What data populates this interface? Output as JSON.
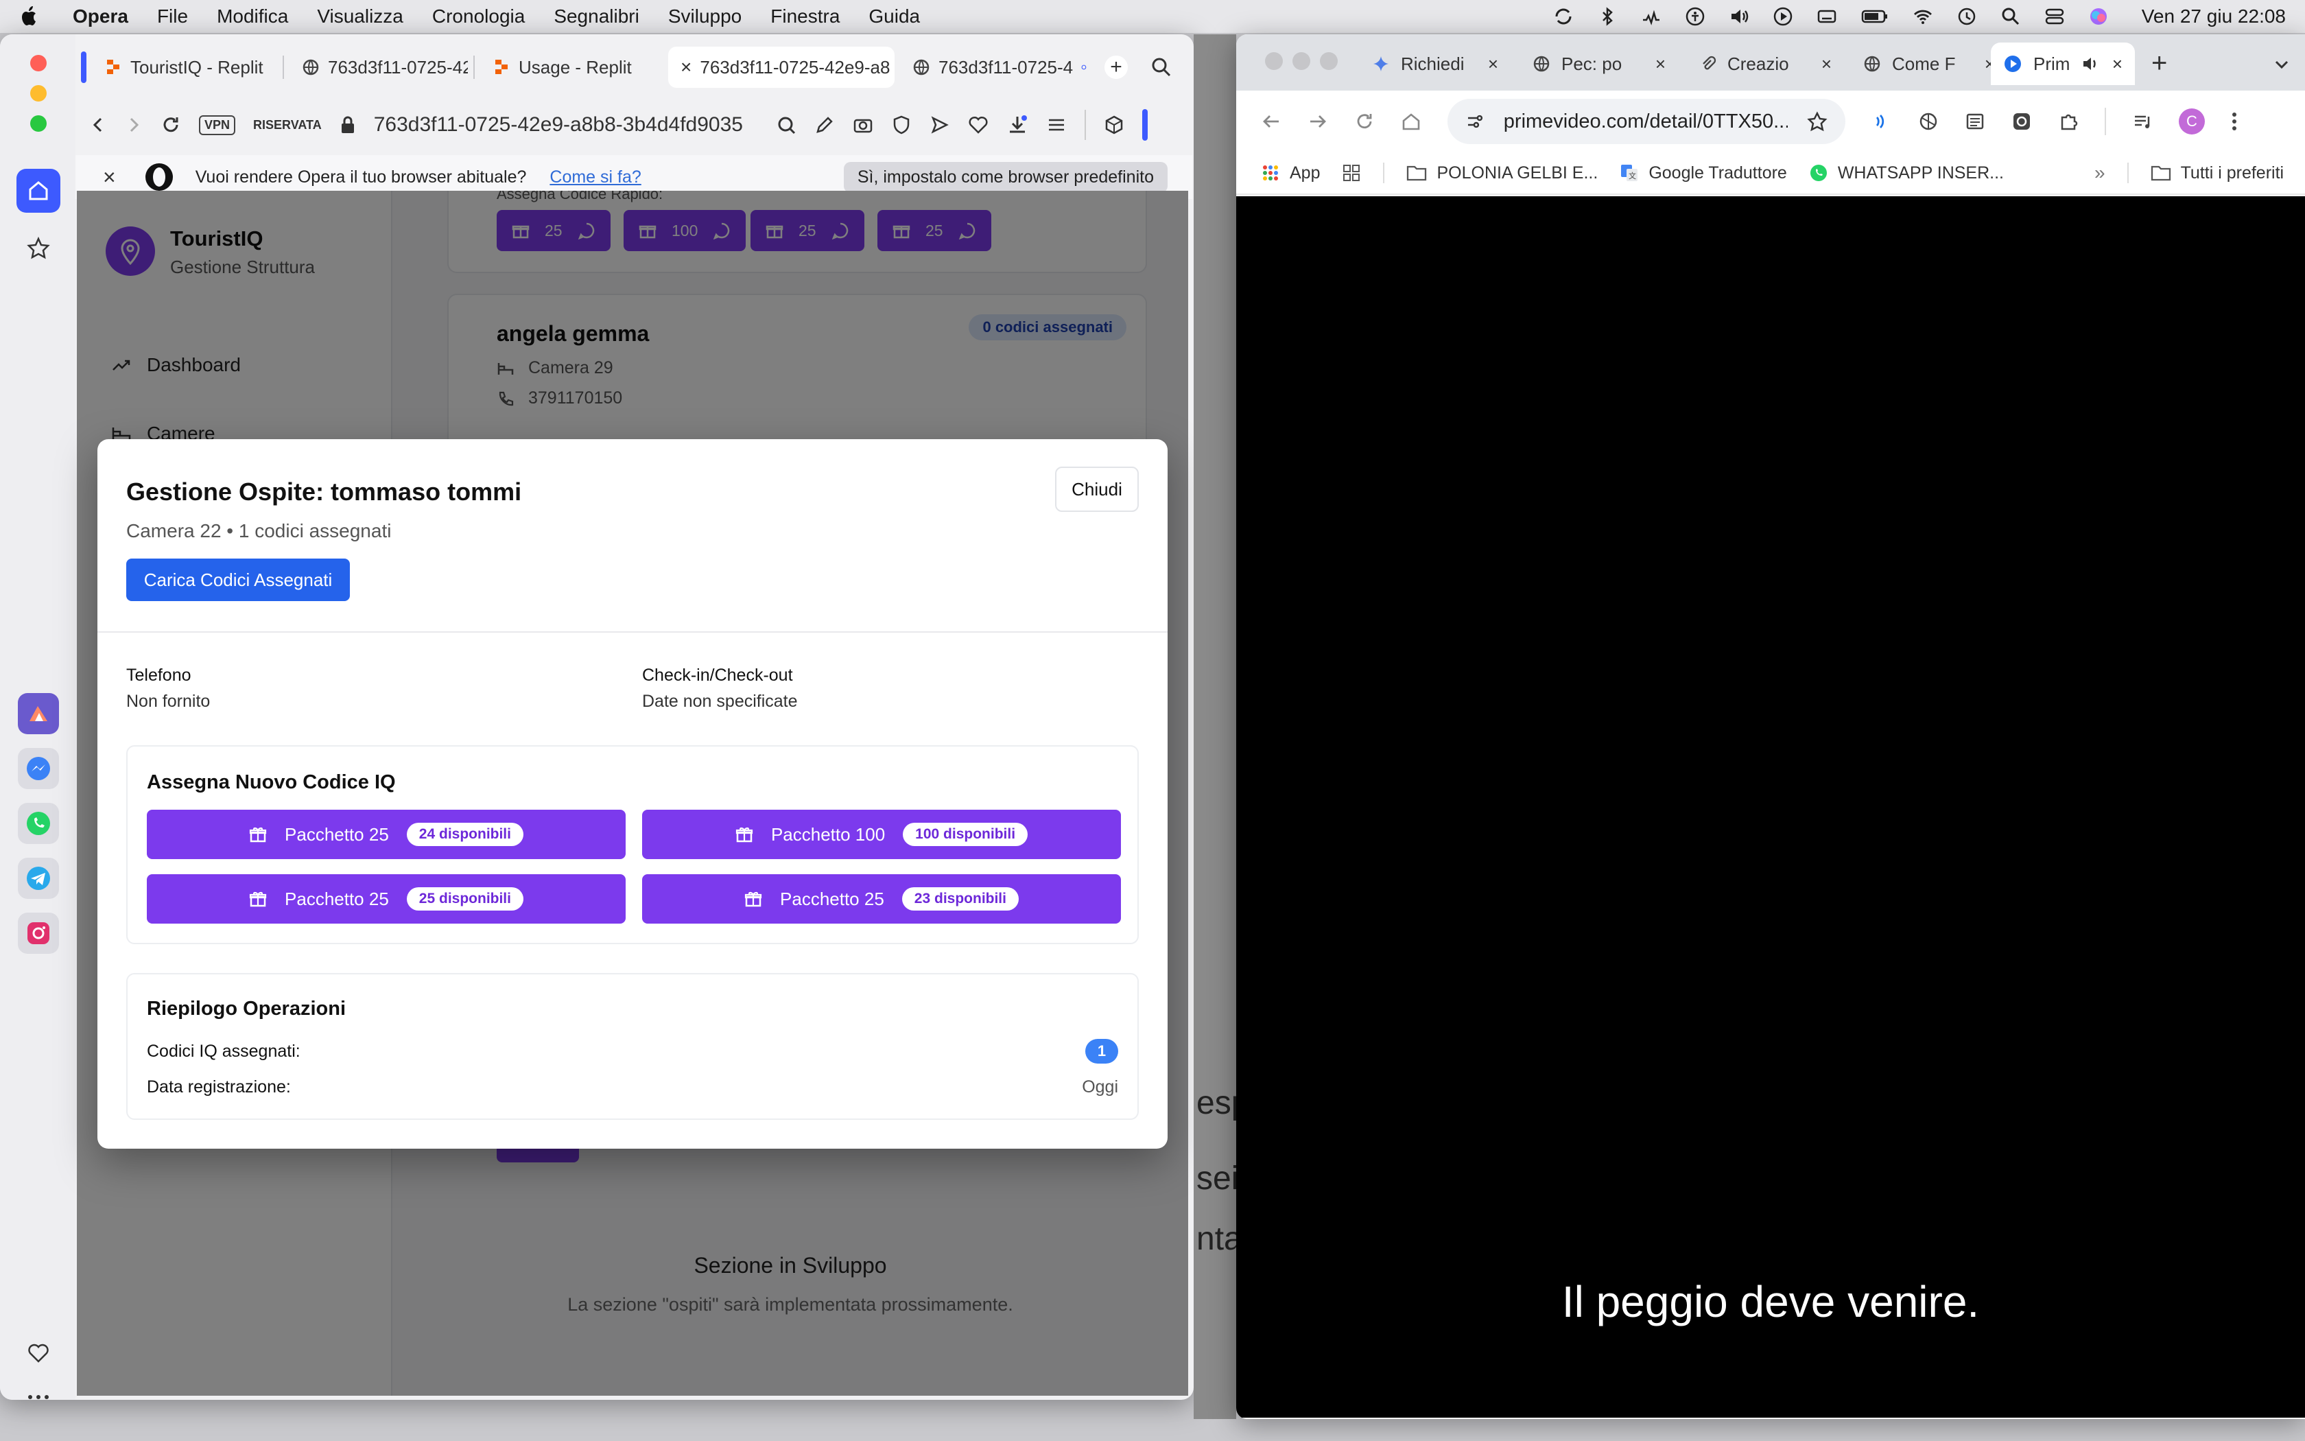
{
  "menubar": {
    "app": "Opera",
    "items": [
      "File",
      "Modifica",
      "Visualizza",
      "Cronologia",
      "Segnalibri",
      "Sviluppo",
      "Finestra",
      "Guida"
    ],
    "clock": "Ven 27 giu  22:08"
  },
  "opera": {
    "tabs": [
      "TouristIQ - Replit",
      "763d3f11-0725-42",
      "Usage - Replit",
      "763d3f11-0725-42e9-a8",
      "763d3f11-0725-4"
    ],
    "vpn": "VPN",
    "privacy": "RISERVATA",
    "url": "763d3f11-0725-42e9-a8b8-3b4d4fd9035",
    "banner": {
      "text": "Vuoi rendere Opera il tuo browser abituale?",
      "link": "Come si fa?",
      "button": "Sì, impostalo come browser predefinito"
    }
  },
  "app": {
    "brand": "TouristIQ",
    "brand_sub": "Gestione Struttura",
    "nav": [
      "Dashboard",
      "Camere"
    ],
    "quick_label": "Assegna Codice Rapido:",
    "quick_buttons": [
      "25",
      "100",
      "25",
      "25"
    ],
    "guest_card": {
      "name": "angela gemma",
      "room": "Camera 29",
      "phone": "3791170150",
      "badge": "0 codici assegnati"
    },
    "dev_title": "Sezione in Sviluppo",
    "dev_sub": "La sezione \"ospiti\" sarà implementata prossimamente."
  },
  "modal": {
    "title": "Gestione Ospite: tommaso tommi",
    "close": "Chiudi",
    "subtitle": "Camera 22 • 1 codici assegnati",
    "load_button": "Carica Codici Assegnati",
    "phone_label": "Telefono",
    "phone_value": "Non fornito",
    "checkin_label": "Check-in/Check-out",
    "checkin_value": "Date non specificate",
    "assign_title": "Assegna Nuovo Codice IQ",
    "packages": [
      {
        "label": "Pacchetto 25",
        "available": "24 disponibili"
      },
      {
        "label": "Pacchetto 100",
        "available": "100 disponibili"
      },
      {
        "label": "Pacchetto 25",
        "available": "25 disponibili"
      },
      {
        "label": "Pacchetto 25",
        "available": "23 disponibili"
      }
    ],
    "summary_title": "Riepilogo Operazioni",
    "summary_codes_label": "Codici IQ assegnati:",
    "summary_codes_value": "1",
    "summary_date_label": "Data registrazione:",
    "summary_date_value": "Oggi"
  },
  "chrome": {
    "tabs": [
      "Richiedi",
      "Pec: po",
      "Creazio",
      "Come F",
      "Prim"
    ],
    "url": "primevideo.com/detail/0TTX50...",
    "bookmarks": [
      "App",
      "POLONIA GELBI E...",
      "Google Traduttore",
      "WHATSAPP INSER...",
      "Tutti i preferiti"
    ],
    "subtitle": "Il peggio deve venire.",
    "avatar_letter": "C"
  },
  "peek": [
    "esp",
    "sei",
    "nta"
  ],
  "colors": {
    "accent_purple": "#7c3aed",
    "accent_blue": "#2563eb",
    "opera_blue": "#3d5afe"
  }
}
